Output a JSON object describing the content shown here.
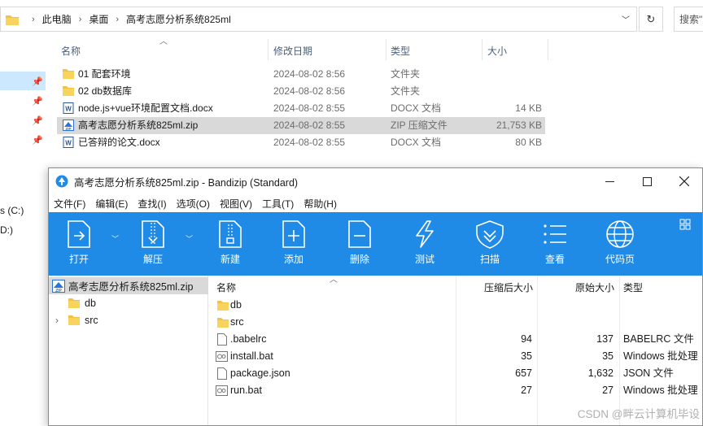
{
  "explorer": {
    "breadcrumb": [
      "此电脑",
      "桌面",
      "高考志愿分析系统825ml"
    ],
    "search_placeholder": "搜索\"",
    "columns": {
      "name": "名称",
      "date": "修改日期",
      "type": "类型",
      "size": "大小"
    },
    "files": [
      {
        "name": "01 配套环境",
        "date": "2024-08-02 8:56",
        "type": "文件夹",
        "size": "",
        "icon": "folder-icon"
      },
      {
        "name": "02 db数据库",
        "date": "2024-08-02 8:56",
        "type": "文件夹",
        "size": "",
        "icon": "folder-icon"
      },
      {
        "name": "node.js+vue环境配置文档.docx",
        "date": "2024-08-02 8:55",
        "type": "DOCX 文档",
        "size": "14 KB",
        "icon": "word-doc-icon"
      },
      {
        "name": "高考志愿分析系统825ml.zip",
        "date": "2024-08-02 8:55",
        "type": "ZIP 压缩文件",
        "size": "21,753 KB",
        "icon": "zip-file-icon"
      },
      {
        "name": "已答辩的论文.docx",
        "date": "2024-08-02 8:55",
        "type": "DOCX 文档",
        "size": "80 KB",
        "icon": "word-doc-icon"
      }
    ],
    "drives": [
      "s (C:)",
      "D:)"
    ]
  },
  "bandizip": {
    "title": "高考志愿分析系统825ml.zip - Bandizip (Standard)",
    "menu": [
      "文件(F)",
      "编辑(E)",
      "查找(I)",
      "选项(O)",
      "视图(V)",
      "工具(T)",
      "帮助(H)"
    ],
    "toolbar": [
      "打开",
      "解压",
      "新建",
      "添加",
      "删除",
      "测试",
      "扫描",
      "查看",
      "代码页"
    ],
    "tree": {
      "root": "高考志愿分析系统825ml.zip",
      "children": [
        "db",
        "src"
      ]
    },
    "columns": {
      "name": "名称",
      "packed": "压缩后大小",
      "original": "原始大小",
      "type": "类型"
    },
    "files": [
      {
        "name": "db",
        "packed": "",
        "original": "",
        "type": "",
        "icon": "folder-icon"
      },
      {
        "name": "src",
        "packed": "",
        "original": "",
        "type": "",
        "icon": "folder-icon"
      },
      {
        "name": ".babelrc",
        "packed": "94",
        "original": "137",
        "type": "BABELRC 文件",
        "icon": "blank-file-icon"
      },
      {
        "name": "install.bat",
        "packed": "35",
        "original": "35",
        "type": "Windows 批处理",
        "icon": "bat-file-icon"
      },
      {
        "name": "package.json",
        "packed": "657",
        "original": "1,632",
        "type": "JSON 文件",
        "icon": "blank-file-icon"
      },
      {
        "name": "run.bat",
        "packed": "27",
        "original": "27",
        "type": "Windows 批处理",
        "icon": "bat-file-icon"
      }
    ]
  },
  "watermark": "CSDN @畔云计算机毕设",
  "colors": {
    "toolbar": "#1f8be6",
    "selection": "#d9d9d9",
    "nav_selection": "#cce8ff",
    "folder": "#f4c242"
  }
}
